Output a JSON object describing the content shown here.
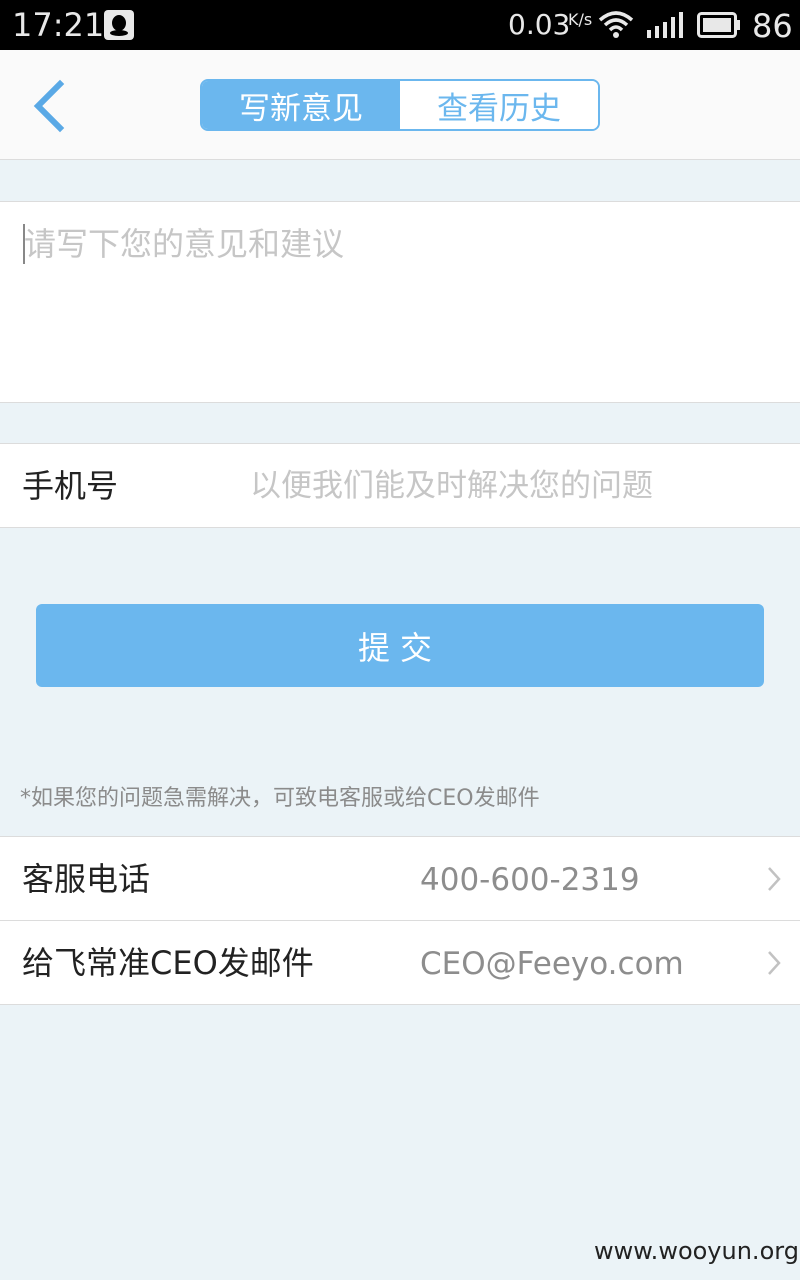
{
  "status_bar": {
    "time": "17:21",
    "net_speed": "0.03",
    "net_unit": "K/s",
    "battery_level": "86",
    "icons": [
      "qq-icon",
      "wifi-icon",
      "signal-icon",
      "battery-icon"
    ]
  },
  "header": {
    "back_icon": "chevron-left-icon",
    "tabs": [
      {
        "label": "写新意见",
        "active": true
      },
      {
        "label": "查看历史",
        "active": false
      }
    ]
  },
  "feedback": {
    "placeholder": "请写下您的意见和建议",
    "value": ""
  },
  "phone": {
    "label": "手机号",
    "placeholder": "以便我们能及时解决您的问题",
    "value": ""
  },
  "submit": {
    "label": "提交"
  },
  "note": "*如果您的问题急需解决，可致电客服或给CEO发邮件",
  "contacts": [
    {
      "label": "客服电话",
      "value": "400-600-2319",
      "icon": "chevron-right-icon"
    },
    {
      "label": "给飞常准CEO发邮件",
      "value": "CEO@Feeyo.com",
      "icon": "chevron-right-icon"
    }
  ],
  "watermark": "www.wooyun.org",
  "colors": {
    "accent": "#6bb7ee",
    "background": "#ebf3f7",
    "placeholder": "#c6c6c6",
    "secondary_text": "#8d8d8d"
  }
}
